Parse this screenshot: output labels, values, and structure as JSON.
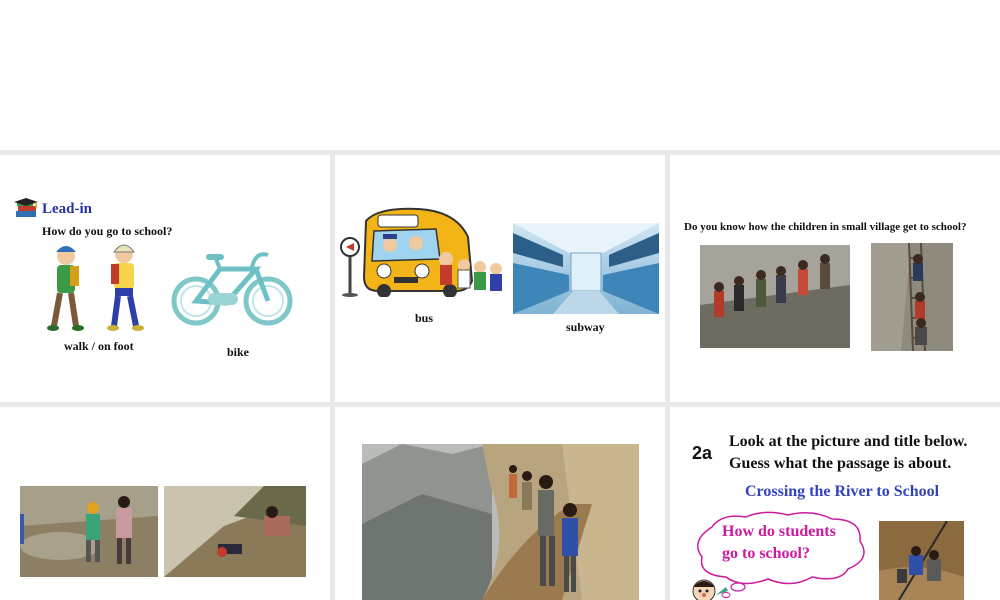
{
  "slides": {
    "s1": {
      "title": "Lead-in",
      "question": "How do you go to school?",
      "walk_label": "walk / on foot",
      "bike_label": "bike"
    },
    "s2": {
      "bus_label": "bus",
      "subway_label": "subway"
    },
    "s3": {
      "question": "Do you know how the children in small village get to school?"
    },
    "s6": {
      "tag": "2a",
      "line1": "Look at the picture and title below.",
      "line2": "Guess what the passage is about.",
      "title": "Crossing the River to School",
      "bubble_line1": "How do students",
      "bubble_line2": "go to school?"
    }
  },
  "colors": {
    "title_blue": "#2233aa",
    "subtitle_blue": "#3344bb",
    "bubble_magenta": "#cc1aa0"
  },
  "icons": {
    "lead_in": "book-stack-icon"
  }
}
